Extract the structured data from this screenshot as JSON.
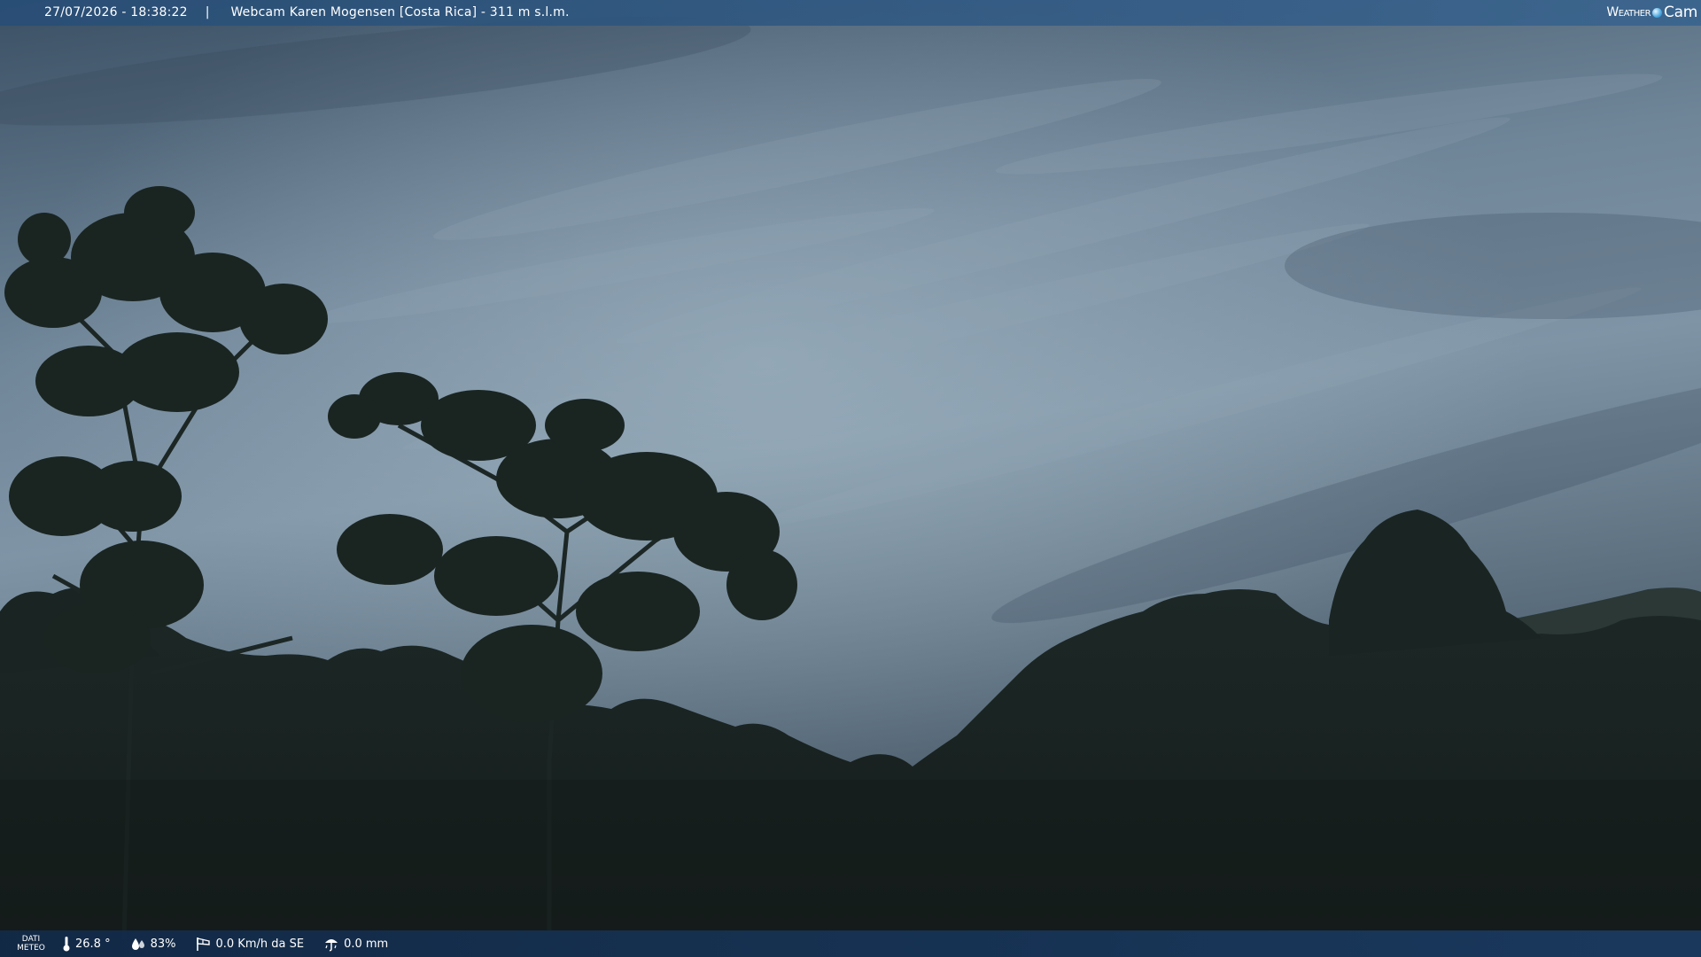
{
  "header": {
    "timestamp": "27/07/2026 - 18:38:22",
    "separator": "|",
    "camera_title": "Webcam Karen Mogensen [Costa Rica]  - 311 m s.l.m.",
    "logo": {
      "part1": "Weather",
      "part2": "Cam"
    }
  },
  "footer": {
    "label_line1": "DATI",
    "label_line2": "METEO",
    "temperature": "26.8 °",
    "humidity": "83%",
    "wind": "0.0 Km/h da SE",
    "rain": "0.0 mm"
  },
  "icons": {
    "temperature": "thermometer-icon",
    "humidity": "humidity-drops-icon",
    "wind": "wind-sock-icon",
    "rain": "rain-gauge-icon",
    "logo_globe": "globe-icon"
  },
  "colors": {
    "sky_top": "#3e5468",
    "sky_mid": "#7d93a4",
    "sky_horizon": "#4f6273",
    "vegetation": "#17211f",
    "bar_top": "#2c5278",
    "bar_bottom": "#173860"
  }
}
